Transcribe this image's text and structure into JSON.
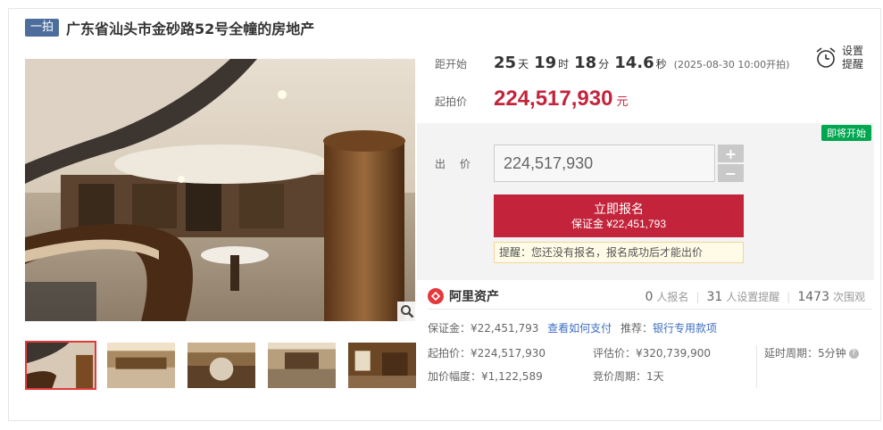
{
  "title": {
    "tag": "一拍",
    "text": "广东省汕头市金砂路52号全幢的房地产"
  },
  "countdown": {
    "label": "距开始",
    "days": "25",
    "days_unit": "天",
    "hours": "19",
    "hours_unit": "时",
    "minutes": "18",
    "minutes_unit": "分",
    "seconds": "14.6",
    "seconds_unit": "秒",
    "start_time": "(2025-08-30 10:00开拍)"
  },
  "remind": {
    "line1": "设置",
    "line2": "提醒",
    "icon": "alarm-clock-icon"
  },
  "start_price": {
    "label": "起拍价",
    "value": "224,517,930",
    "unit": "元"
  },
  "bid": {
    "badge": "即将开始",
    "label": "出 价",
    "value": "224,517,930",
    "plus": "+",
    "minus": "−",
    "signup_main": "立即报名",
    "signup_sub": "保证金 ¥22,451,793",
    "hint": "提醒：您还没有报名，报名成功后才能出价"
  },
  "platform": {
    "logo_text": "阿里资产",
    "signups": "0",
    "signups_label": "人报名",
    "reminders": "31",
    "reminders_label": "人设置提醒",
    "views": "1473",
    "views_label": "次围观"
  },
  "details": {
    "deposit": "保证金：¥22,451,793",
    "how_to_pay": "查看如何支付",
    "recommend_label": "推荐：",
    "recommend_link": "银行专用款项",
    "start_price": "起拍价：¥224,517,930",
    "appraisal": "评估价：¥320,739,900",
    "delay": "延时周期：5分钟",
    "increment": "加价幅度：¥1,122,589",
    "cycle": "竞价周期：1天"
  },
  "colors": {
    "accent_red": "#c3243b",
    "tag_blue": "#4d6e9c",
    "link_blue": "#3f6ec1",
    "badge_green": "#00a650"
  }
}
